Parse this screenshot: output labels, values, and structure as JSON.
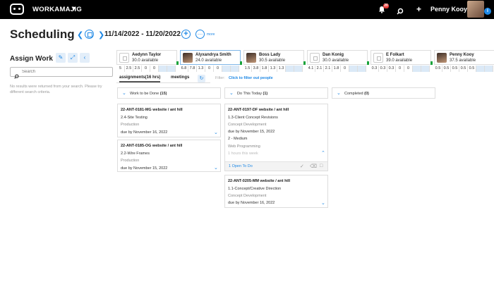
{
  "topbar": {
    "brand": "WORKAMAJIG",
    "notification_count": "20",
    "user_name": "Penny Kooy",
    "info": "i"
  },
  "header": {
    "title": "Scheduling",
    "date_range": "11/14/2022 - 11/20/2022",
    "more_label": "more"
  },
  "left_panel": {
    "title": "Assign Work",
    "search_placeholder": "Search",
    "search_value": "",
    "no_results": "No results were returned from your search. Please try different search criteria."
  },
  "people": [
    {
      "name": "Aedynn Taylor",
      "available": "30.0 available",
      "avatar": "blank",
      "selected": false,
      "hours": [
        "5",
        "2.5",
        "2.5",
        "0",
        "0",
        "",
        ""
      ]
    },
    {
      "name": "Alyxandrya Smith",
      "available": "24.0 available",
      "avatar": "photo",
      "selected": true,
      "hours": [
        "6.8",
        "7.8",
        "1.3",
        "0",
        "0",
        "",
        ""
      ]
    },
    {
      "name": "Boss Lady",
      "available": "30.5 available",
      "avatar": "photo",
      "selected": false,
      "hours": [
        "1.5",
        "3.8",
        "1.8",
        "1.3",
        "1.3",
        "",
        ""
      ]
    },
    {
      "name": "Dan Konig",
      "available": "30.0 available",
      "avatar": "blank",
      "selected": false,
      "hours": [
        "4.1",
        "2.1",
        "2.1",
        "1.8",
        "0",
        "",
        ""
      ]
    },
    {
      "name": "E Folkart",
      "available": "39.0 available",
      "avatar": "blank",
      "selected": false,
      "hours": [
        "0.3",
        "0.3",
        "0.3",
        "0",
        "0",
        "",
        ""
      ]
    },
    {
      "name": "Penny Kooy",
      "available": "37.5 available",
      "avatar": "photo",
      "selected": false,
      "hours": [
        "0.5",
        "0.5",
        "0.5",
        "0.5",
        "0.5",
        "",
        ""
      ]
    }
  ],
  "tabs": {
    "assignments": "assignments(16 hrs)",
    "meetings": "meetings"
  },
  "filter": {
    "label": "Filter:",
    "link": "Click to filter out people"
  },
  "columns": {
    "todo": {
      "title": "Work to be Done",
      "count": "(15)"
    },
    "today": {
      "title": "Do This Today",
      "count": "(1)"
    },
    "completed": {
      "title": "Completed",
      "count": "(0)"
    }
  },
  "cards": {
    "c1": {
      "title": "22-ANT-0181-MG website / ant hill",
      "task": "2.4-Site Testing",
      "dept": "Production",
      "due": "due by November 16, 2022"
    },
    "c2": {
      "title": "22-ANT-0185-OG website / ant hill",
      "task": "2.2-Wire Frames",
      "dept": "Production",
      "due": "due by November 15, 2022"
    },
    "c3": {
      "title": "22-ANT-0197-DF website / ant hill",
      "task": "1.3-Client Concept Revisions",
      "dept": "Concept Development",
      "due": "due by November 15, 2022",
      "priority": "2 - Medium",
      "service": "Web Programming",
      "hours": "1 hours this week",
      "todo": "1 Open To Do"
    },
    "c4": {
      "title": "22-ANT-0205-MM website / ant hill",
      "task": "1.1-Concept/Creative Direction",
      "dept": "Concept Development",
      "due": "due by November 16, 2022"
    }
  }
}
